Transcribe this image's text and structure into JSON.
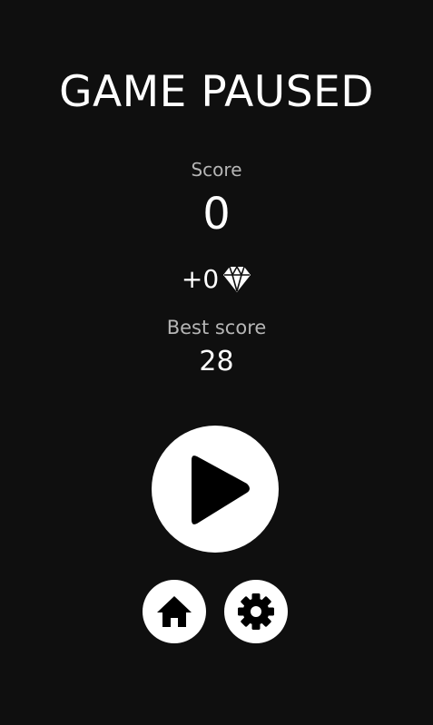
{
  "pause_menu": {
    "title": "GAME PAUSED",
    "score_label": "Score",
    "score_value": "0",
    "gems_earned": "+0",
    "best_score_label": "Best score",
    "best_score_value": "28"
  },
  "controls": {
    "play_icon": "play-icon",
    "home_icon": "home-icon",
    "settings_icon": "gear-icon",
    "gem_icon": "diamond-icon"
  },
  "colors": {
    "background": "#0f0f0f",
    "primary_text": "#ffffff",
    "secondary_text": "#b5b5b5",
    "button_fill": "#ffffff",
    "icon_fill": "#000000"
  }
}
